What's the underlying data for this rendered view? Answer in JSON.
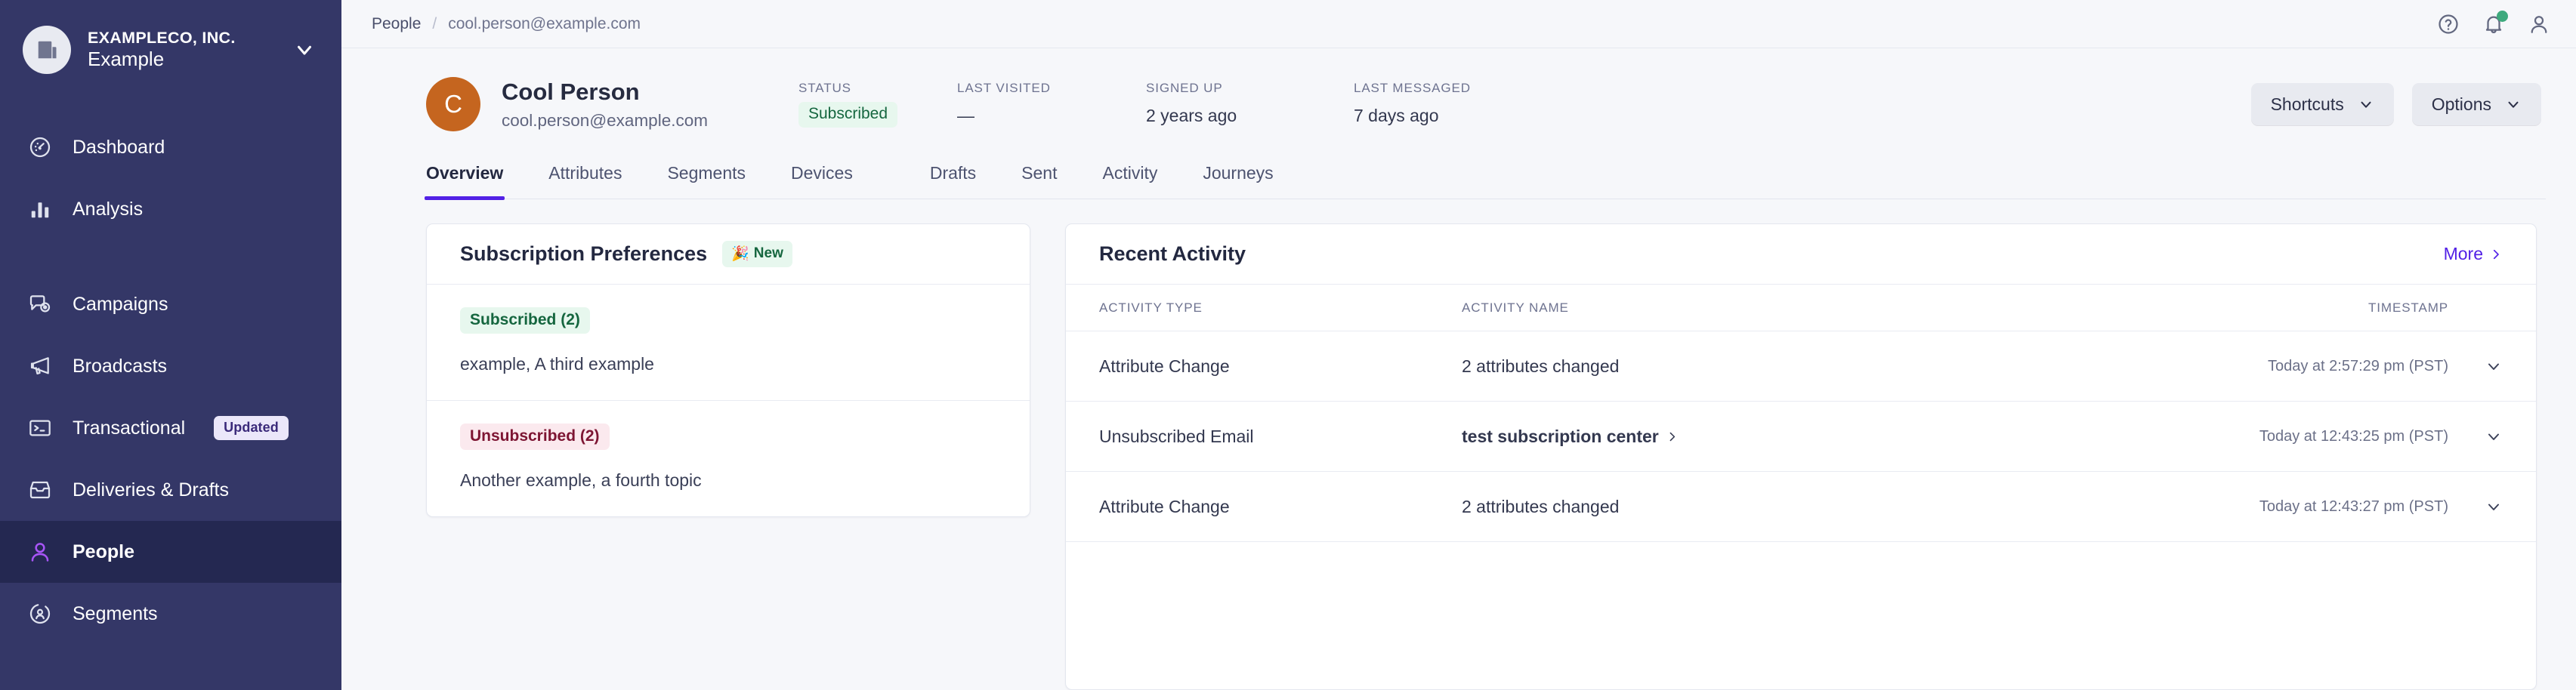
{
  "sidebar": {
    "org": {
      "name": "EXAMPLECO, INC.",
      "workspace": "Example",
      "chevron_icon": "chevron-down-icon",
      "avatar_icon": "building-icon"
    },
    "groups": [
      {
        "items": [
          {
            "label": "Dashboard",
            "icon": "gauge-icon",
            "active": false
          },
          {
            "label": "Analysis",
            "icon": "bar-chart-icon",
            "active": false
          }
        ]
      },
      {
        "items": [
          {
            "label": "Campaigns",
            "icon": "campaign-icon",
            "active": false
          },
          {
            "label": "Broadcasts",
            "icon": "megaphone-icon",
            "active": false
          },
          {
            "label": "Transactional",
            "icon": "terminal-icon",
            "active": false,
            "badge": "Updated"
          },
          {
            "label": "Deliveries & Drafts",
            "icon": "inbox-icon",
            "active": false
          },
          {
            "label": "People",
            "icon": "person-icon",
            "active": true
          },
          {
            "label": "Segments",
            "icon": "segment-icon",
            "active": false
          }
        ]
      }
    ]
  },
  "topbar": {
    "breadcrumb": {
      "root": "People",
      "separator": "/",
      "current": "cool.person@example.com"
    },
    "icons": [
      {
        "name": "help-icon"
      },
      {
        "name": "notifications-bell-icon",
        "has_dot": true
      },
      {
        "name": "account-avatar-icon"
      }
    ]
  },
  "person": {
    "avatar_initial": "C",
    "avatar_color": "#c5651f",
    "name": "Cool Person",
    "email": "cool.person@example.com",
    "meta": [
      {
        "label": "STATUS",
        "value": "Subscribed",
        "style": "chip-green"
      },
      {
        "label": "LAST VISITED",
        "value": "—",
        "style": "plain"
      },
      {
        "label": "SIGNED UP",
        "value": "2 years ago",
        "style": "plain"
      },
      {
        "label": "LAST MESSAGED",
        "value": "7 days ago",
        "style": "plain"
      }
    ],
    "actions": [
      {
        "label": "Shortcuts",
        "icon": "chevron-down-icon"
      },
      {
        "label": "Options",
        "icon": "chevron-down-icon"
      }
    ]
  },
  "tabs": [
    {
      "label": "Overview",
      "active": true
    },
    {
      "label": "Attributes",
      "active": false
    },
    {
      "label": "Segments",
      "active": false
    },
    {
      "label": "Devices",
      "active": false
    },
    {
      "label": "Drafts",
      "active": false,
      "gap": true
    },
    {
      "label": "Sent",
      "active": false
    },
    {
      "label": "Activity",
      "active": false
    },
    {
      "label": "Journeys",
      "active": false
    }
  ],
  "subscription_preferences": {
    "title": "Subscription Preferences",
    "badge": {
      "emoji": "🎉",
      "text": "New"
    },
    "blocks": [
      {
        "chip": "Subscribed (2)",
        "chip_type": "sub",
        "items": "example, A third example"
      },
      {
        "chip": "Unsubscribed (2)",
        "chip_type": "unsub",
        "items": "Another example, a fourth topic"
      }
    ]
  },
  "recent_activity": {
    "title": "Recent Activity",
    "more_label": "More",
    "more_icon": "chevron-right-icon",
    "columns": [
      "ACTIVITY TYPE",
      "ACTIVITY NAME",
      "TIMESTAMP"
    ],
    "rows": [
      {
        "type": "Attribute Change",
        "name": "2 attributes changed",
        "is_link": false,
        "timestamp": "Today at 2:57:29 pm (PST)",
        "chevron_icon": "chevron-down-icon"
      },
      {
        "type": "Unsubscribed Email",
        "name": "test subscription center",
        "is_link": true,
        "timestamp": "Today at 12:43:25 pm (PST)",
        "chevron_icon": "chevron-down-icon"
      },
      {
        "type": "Attribute Change",
        "name": "2 attributes changed",
        "is_link": false,
        "timestamp": "Today at 12:43:27 pm (PST)",
        "chevron_icon": "chevron-down-icon"
      }
    ]
  },
  "colors": {
    "sidebar_bg": "#343767",
    "sidebar_active_bg": "#242851",
    "accent_purple": "#5221e6",
    "status_green_bg": "#e7f7ee",
    "status_green_text": "#15663f",
    "status_red_bg": "#fbe9ee",
    "status_red_text": "#7d1533",
    "page_bg": "#f6f7fa",
    "notification_dot": "#3ea97d"
  }
}
